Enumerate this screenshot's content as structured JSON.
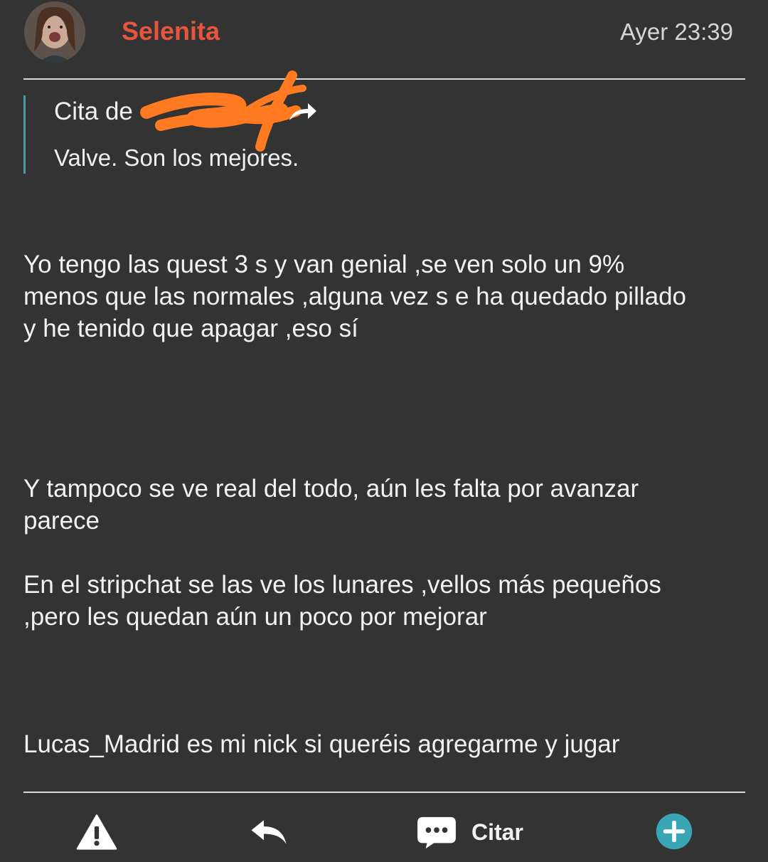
{
  "post": {
    "username": "Selenita",
    "timestamp": "Ayer 23:39",
    "quote": {
      "prefix": "Cita de",
      "text": "Valve. Son los mejores."
    },
    "paragraphs": [
      "Yo tengo las quest 3 s y van genial ,se ven solo un 9%\nmenos que las normales ,alguna vez s e ha quedado pillado\ny he tenido que apagar ,eso sí",
      "Y tampoco se ve real del todo, aún les falta por avanzar\nparece",
      "En el stripchat se las ve los lunares ,vellos más pequeños\n,pero les quedan aún un poco por mejorar",
      "Lucas_Madrid es mi nick si queréis agregarme y jugar"
    ]
  },
  "toolbar": {
    "report_icon": "warning-icon",
    "reply_icon": "reply-icon",
    "quote_icon": "chat-bubble-icon",
    "quote_label": "Citar",
    "add_icon": "plus-circle-icon"
  },
  "colors": {
    "background": "#333333",
    "username": "#e8553f",
    "quote_bar": "#4a9aa6",
    "redaction": "#ff7a21",
    "accent": "#3aa6b5"
  }
}
